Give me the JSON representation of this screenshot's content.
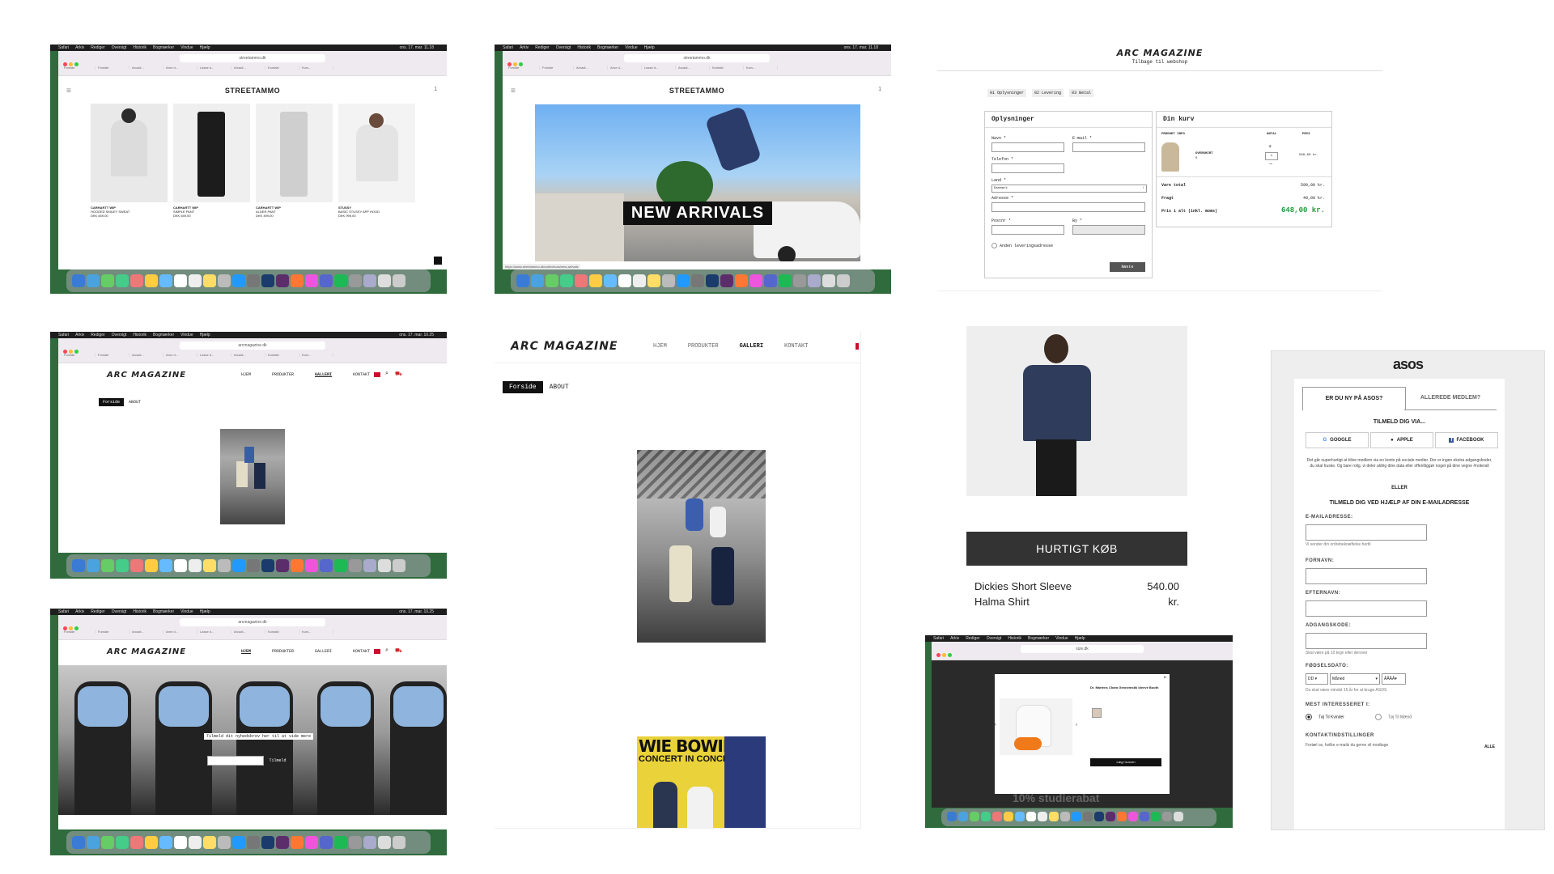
{
  "menu_bar": {
    "items": [
      "Safari",
      "Arkiv",
      "Rediger",
      "Oversigt",
      "Historik",
      "Bogmærker",
      "Vindue",
      "Hjælp"
    ],
    "time_a": "ons. 17. mar. 11.18",
    "time_b": "ons. 17. mar. 10.25"
  },
  "tabs": [
    "Forside",
    "Forside",
    "Arcadi...",
    "Arne d...",
    "Lasse d...",
    "Arcadi...",
    "Kontakt",
    "Kurv..."
  ],
  "tile1": {
    "url": "streetammo.dk",
    "logo": "STREETAMMO",
    "page_num": "1",
    "products": [
      {
        "brand": "CARHARTT WIP",
        "name": "HOODED SMILEY SWEAT",
        "price": "DKK 849,00",
        "color": "#dcdcdc"
      },
      {
        "brand": "CARHARTT WIP",
        "name": "SIMPLE PANT",
        "price": "DKK 549,00",
        "color": "#1c1c1c"
      },
      {
        "brand": "CARHARTT WIP",
        "name": "ALDER PANT",
        "price": "DKK 499,00",
        "color": "#cfcfcf"
      },
      {
        "brand": "STUSSY",
        "name": "BASIC STUSSY APP HOOD",
        "price": "DKK 999,00",
        "color": "#eeeeee"
      }
    ]
  },
  "tile2": {
    "url": "streetammo.dk",
    "logo": "STREETAMMO",
    "page_num": "1",
    "banner": "NEW ARRIVALS",
    "status_url": "https://www.streetammo.dk/collections/new-arrivals"
  },
  "checkout": {
    "logo": "ARC MAGAZINE",
    "back_link": "Tilbage til webshop",
    "steps": [
      "01 Oplysninger",
      "02 Levering",
      "03 Betal"
    ],
    "form_title": "Oplysninger",
    "labels": {
      "name": "Navn *",
      "email": "E-mail *",
      "phone": "Telefon *",
      "country": "Land *",
      "address": "Adresse *",
      "zip": "Postnr *",
      "city": "By *"
    },
    "country_value": "Danmark",
    "alt_delivery": "Anden leveringsadresse",
    "next_button": "Næste",
    "cart_title": "Din kurv",
    "cart_headers": [
      "PRODUKT INFO",
      "ANTAL",
      "PRIS"
    ],
    "cart_item": {
      "name": "OVERSHIRT",
      "variant": "S",
      "qty": "1",
      "price": "599,00 kr."
    },
    "totals": [
      {
        "label": "Vare total",
        "value": "599,00 kr."
      },
      {
        "label": "Fragt",
        "value": "49,00 kr."
      }
    ],
    "grand_label": "Pris i alt (inkl. moms)",
    "grand_value": "648,00 kr."
  },
  "tile4": {
    "url": "arcmagazine.dk",
    "logo": "ARC MAGAZINE",
    "nav": [
      "HJEM",
      "PRODUKTER",
      "GALLERI",
      "KONTAKT"
    ],
    "crumb_home": "Forside",
    "crumb_current": "ABOUT"
  },
  "tile5": {
    "logo": "ARC MAGAZINE",
    "nav": [
      "HJEM",
      "PRODUKTER",
      "GALLERI",
      "KONTAKT"
    ],
    "crumb_home": "Forside",
    "crumb_current": "ABOUT",
    "poster_text": "WIE BOWIE",
    "poster_sub": "CONCERT IN CONCERT"
  },
  "product": {
    "button": "HURTIGT KØB",
    "name": "Dickies Short Sleeve Halma Shirt",
    "price": "540.00 kr."
  },
  "tile7": {
    "url": "arcmagazine.dk",
    "logo": "ARC MAGAZINE",
    "nav": [
      "HJEM",
      "PRODUKTER",
      "GALLERI",
      "KONTAKT"
    ],
    "newsletter": "Tilmeld dit nyhedsbrev her til at vide mere",
    "subscribe": "Tilmeld"
  },
  "tile8": {
    "url": "size.dk",
    "modal_title": "Dr. Martens Chara Gennemstik bleeve Booth",
    "add_button": "Læg i kurven",
    "banner": "10% studierabat"
  },
  "asos": {
    "logo": "asos",
    "tab_new": "ER DU NY PÅ ASOS?",
    "tab_member": "ALLEREDE MEDLEM?",
    "signup_via": "TILMELD DIG VIA...",
    "social": [
      "GOOGLE",
      "APPLE",
      "FACEBOOK"
    ],
    "social_note": "Det går superhurtigt at blive medlem via en konto på sociale medier. Der er ingen ekstra adgangskoder, du skal huske. Og bare rolig, vi deler aldrig dine data eller offentliggør noget på dine vegne #noterall",
    "or": "ELLER",
    "email_heading": "TILMELD DIG VED HJÆLP AF DIN E-MAILADRESSE",
    "email_label": "E-MAILADRESSE:",
    "email_hint": "Vi sender din ordrebekræftelse hertil",
    "firstname_label": "FORNAVN:",
    "lastname_label": "EFTERNAVN:",
    "password_label": "ADGANGSKODE:",
    "password_hint": "Skal være på 10 tegn eller derover",
    "dob_label": "FØDSELSDATO:",
    "dob_day": "DD",
    "dob_month": "Måned",
    "dob_year": "ÅÅÅÅ",
    "dob_hint": "Du skal være mindst 16 år for at bruge ASOS",
    "interest_label": "MEST INTERESSERET I:",
    "interest_a": "Tøj Til Kvinder",
    "interest_b": "Tøj Til Mænd",
    "contact_label": "KONTAKTINDSTILLINGER",
    "contact_note": "Fortæl os, hvilke e-mails du gerne vil modtage",
    "all": "ALLE"
  },
  "colors": {
    "desktop": "#2f6b3c",
    "green_price": "#1f9a3a",
    "dark_button": "#333333"
  }
}
